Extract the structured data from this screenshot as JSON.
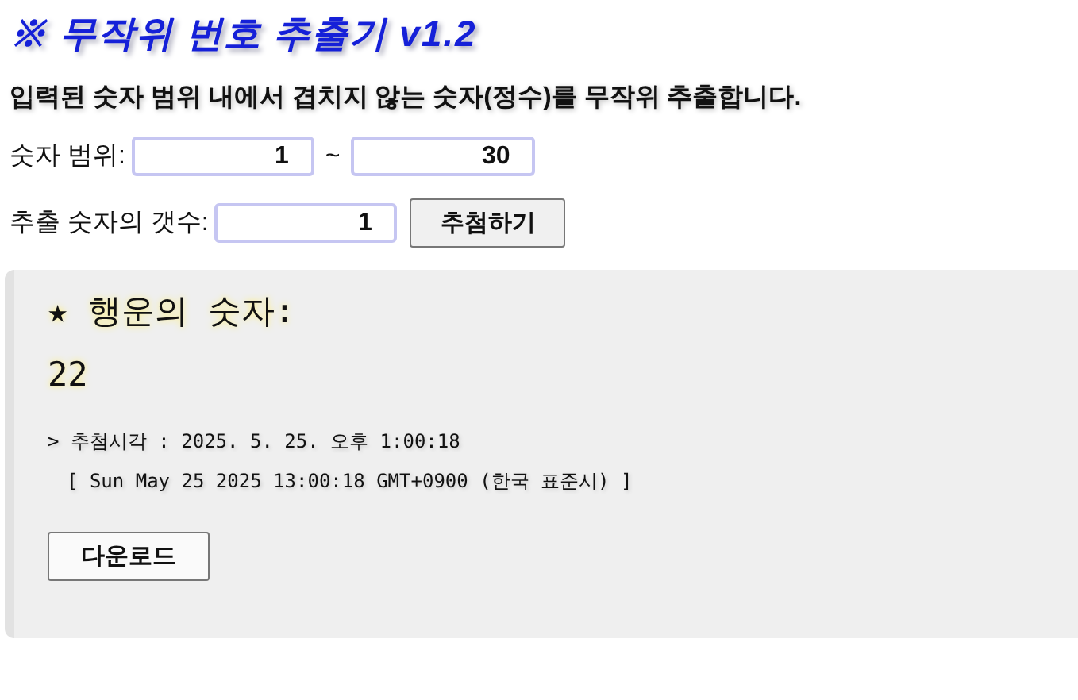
{
  "title": "※ 무작위 번호 추출기 v1.2",
  "description": "입력된 숫자 범위 내에서 겹치지 않는 숫자(정수)를 무작위 추출합니다.",
  "range": {
    "label": "숫자 범위:",
    "from": "1",
    "separator": "~",
    "to": "30"
  },
  "count": {
    "label": "추출 숫자의 갯수:",
    "value": "1",
    "button": "추첨하기"
  },
  "result": {
    "heading": "★ 행운의 숫자:",
    "numbers": "22",
    "time": "> 추첨시각 : 2025. 5. 25. 오후 1:00:18",
    "full_time": "[ Sun May 25 2025 13:00:18 GMT+0900 (한국 표준시) ]",
    "button": "다운로드"
  }
}
